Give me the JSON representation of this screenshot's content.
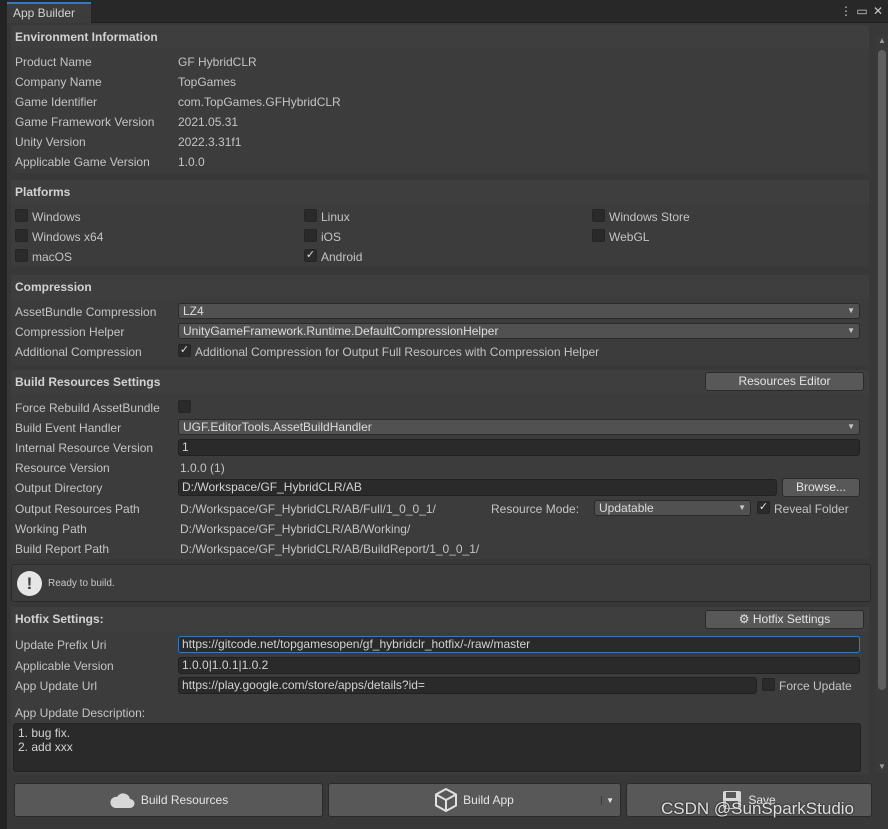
{
  "window": {
    "tab_title": "App Builder",
    "menu_icon": "kebab-icon",
    "max_icon": "maximize-icon",
    "close_icon": "close-icon"
  },
  "environment": {
    "header": "Environment Information",
    "rows": [
      {
        "label": "Product Name",
        "value": "GF HybridCLR"
      },
      {
        "label": "Company Name",
        "value": "TopGames"
      },
      {
        "label": "Game Identifier",
        "value": "com.TopGames.GFHybridCLR"
      },
      {
        "label": "Game Framework Version",
        "value": "2021.05.31"
      },
      {
        "label": "Unity Version",
        "value": "2022.3.31f1"
      },
      {
        "label": "Applicable Game Version",
        "value": "1.0.0"
      }
    ]
  },
  "platforms": {
    "header": "Platforms",
    "items": [
      {
        "label": "Windows",
        "checked": false
      },
      {
        "label": "Linux",
        "checked": false
      },
      {
        "label": "Windows Store",
        "checked": false
      },
      {
        "label": "Windows x64",
        "checked": false
      },
      {
        "label": "iOS",
        "checked": false
      },
      {
        "label": "WebGL",
        "checked": false
      },
      {
        "label": "macOS",
        "checked": false
      },
      {
        "label": "Android",
        "checked": true
      }
    ]
  },
  "compression": {
    "header": "Compression",
    "assetbundle_label": "AssetBundle Compression",
    "assetbundle_value": "LZ4",
    "helper_label": "Compression Helper",
    "helper_value": "UnityGameFramework.Runtime.DefaultCompressionHelper",
    "additional_label": "Additional Compression",
    "additional_checked": true,
    "additional_text": "Additional Compression for Output Full Resources with Compression Helper"
  },
  "build_resources": {
    "header": "Build Resources Settings",
    "resources_editor_button": "Resources Editor",
    "force_rebuild_label": "Force Rebuild AssetBundle",
    "force_rebuild_checked": false,
    "build_event_label": "Build Event Handler",
    "build_event_value": "UGF.EditorTools.AssetBuildHandler",
    "internal_version_label": "Internal Resource Version",
    "internal_version_value": "1",
    "resource_version_label": "Resource Version",
    "resource_version_value": "1.0.0 (1)",
    "output_dir_label": "Output Directory",
    "output_dir_value": "D:/Workspace/GF_HybridCLR/AB",
    "browse_button": "Browse...",
    "output_path_label": "Output Resources Path",
    "output_path_value": "D:/Workspace/GF_HybridCLR/AB/Full/1_0_0_1/",
    "resource_mode_label": "Resource Mode:",
    "resource_mode_value": "Updatable",
    "reveal_folder_label": "Reveal Folder",
    "reveal_folder_checked": true,
    "working_path_label": "Working Path",
    "working_path_value": "D:/Workspace/GF_HybridCLR/AB/Working/",
    "build_report_label": "Build Report Path",
    "build_report_value": "D:/Workspace/GF_HybridCLR/AB/BuildReport/1_0_0_1/"
  },
  "status": {
    "icon": "info-icon",
    "message": "Ready to build."
  },
  "hotfix": {
    "header": "Hotfix Settings:",
    "settings_button": "Hotfix Settings",
    "settings_icon": "gear-icon",
    "update_prefix_label": "Update Prefix Uri",
    "update_prefix_value": "https://gitcode.net/topgamesopen/gf_hybridclr_hotfix/-/raw/master",
    "applicable_version_label": "Applicable Version",
    "applicable_version_value": "1.0.0|1.0.1|1.0.2",
    "app_update_url_label": "App Update Url",
    "app_update_url_value": "https://play.google.com/store/apps/details?id=",
    "force_update_label": "Force Update",
    "force_update_checked": false,
    "description_label": "App Update Description:",
    "description_lines": [
      "1. bug fix.",
      "2. add xxx"
    ]
  },
  "actions": {
    "build_resources": "Build Resources",
    "build_resources_icon": "cloud-icon",
    "build_app": "Build App",
    "build_app_icon": "unity-cube-icon",
    "save": "Save",
    "save_icon": "floppy-icon"
  },
  "watermark": "CSDN @SunSparkStudio",
  "colors": {
    "accent": "#3a79bb",
    "panel": "#383838",
    "header": "#3e3e3e",
    "field": "#2a2a2a",
    "button": "#585858"
  }
}
